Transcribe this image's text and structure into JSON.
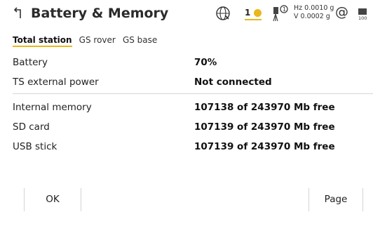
{
  "header": {
    "title": "Battery & Memory",
    "back_icon": "back-arrow-icon",
    "status": {
      "satellite_count": "1",
      "hz_angle": "Hz 0.0010 g",
      "v_angle": "V  0.0002 g",
      "at_symbol": "@",
      "battery_text": "100"
    }
  },
  "tabs": [
    {
      "label": "Total station",
      "active": true
    },
    {
      "label": "GS rover",
      "active": false
    },
    {
      "label": "GS base",
      "active": false
    }
  ],
  "rows": [
    {
      "label": "Battery",
      "value": "70%"
    },
    {
      "label": "TS external power",
      "value": "Not connected"
    },
    {
      "label": "Internal memory",
      "value": "107138 of 243970 Mb free"
    },
    {
      "label": "SD card",
      "value": "107139 of 243970 Mb free"
    },
    {
      "label": "USB stick",
      "value": "107139 of 243970 Mb free"
    }
  ],
  "footer": {
    "ok_label": "OK",
    "page_label": "Page"
  },
  "colors": {
    "accent": "#e8b81c",
    "text": "#222222",
    "divider": "#d6d6d6"
  }
}
